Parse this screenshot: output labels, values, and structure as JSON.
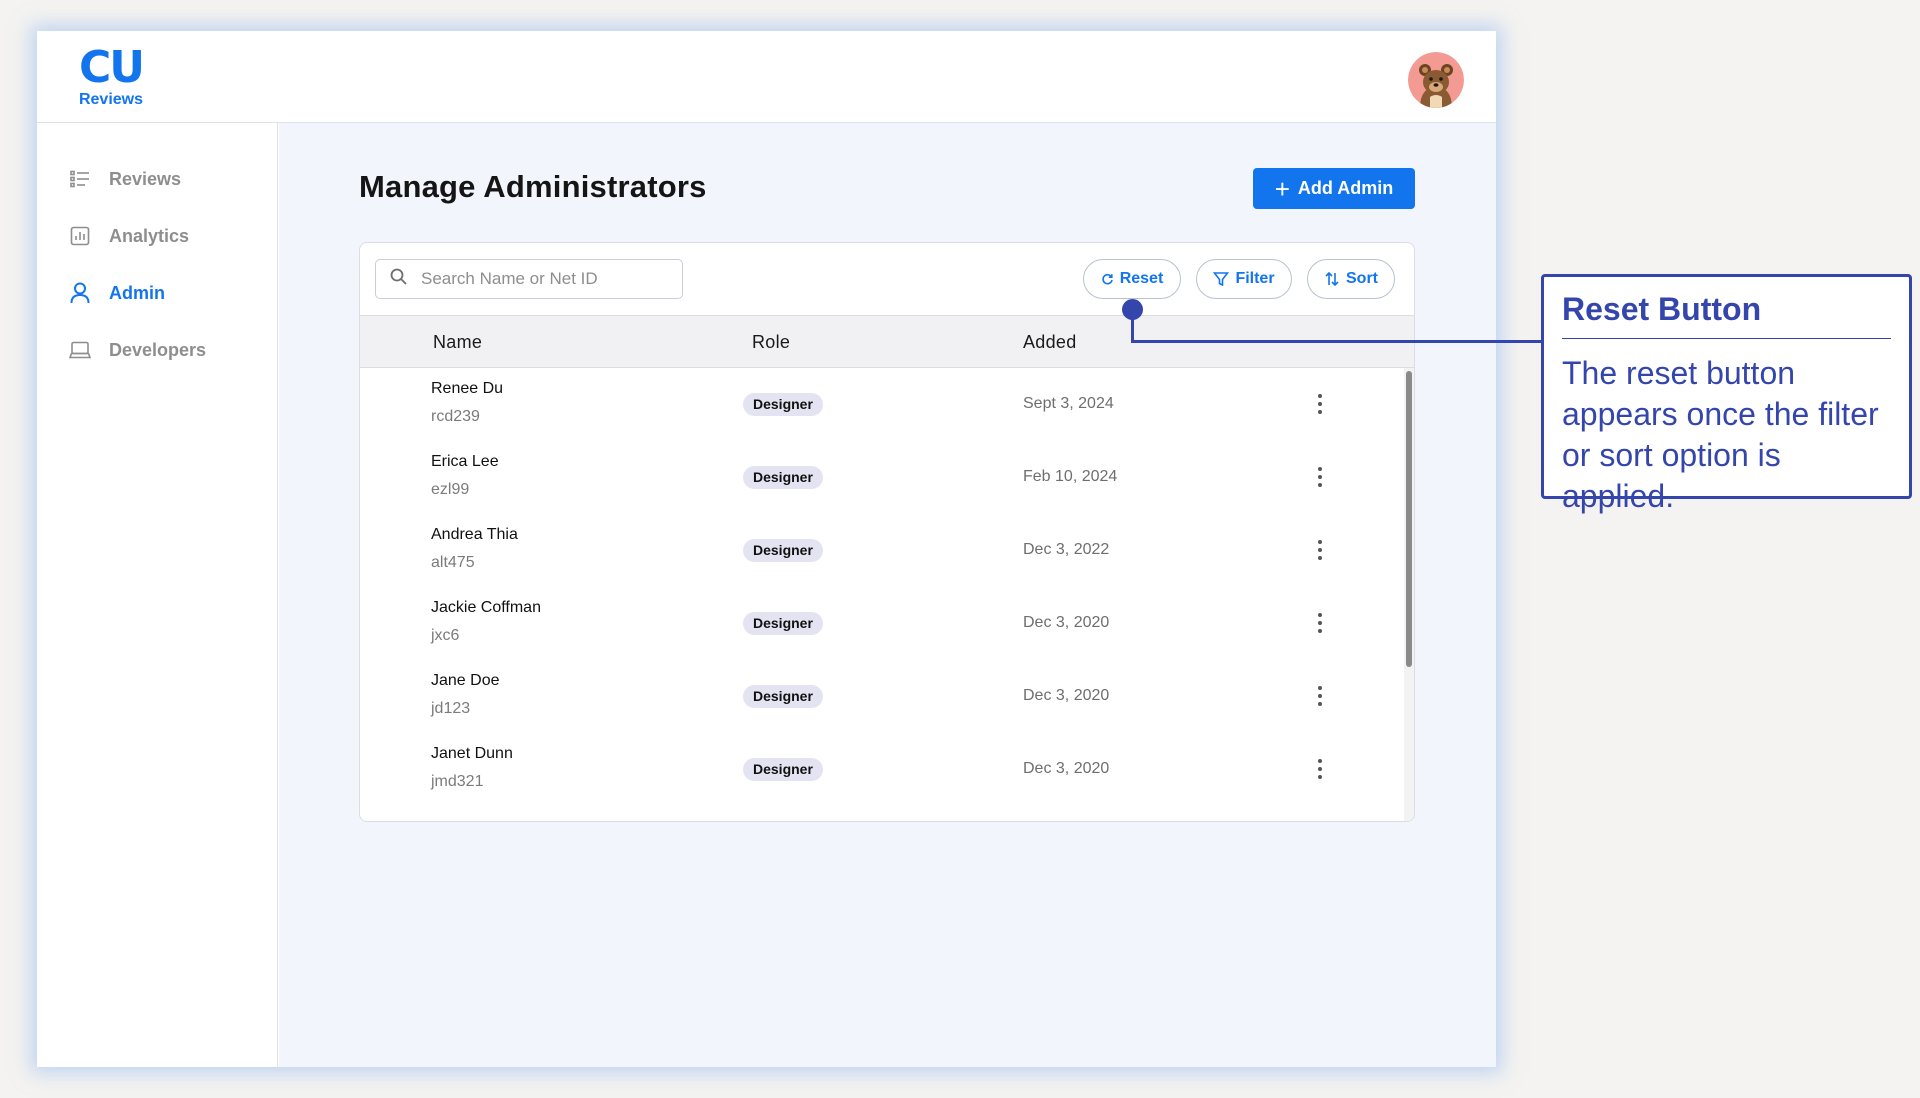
{
  "app": {
    "logo_mark": "CU",
    "logo_text": "Reviews",
    "accent_color": "#1375ee"
  },
  "sidebar": {
    "items": [
      {
        "label": "Reviews",
        "icon": "list-icon",
        "active": false
      },
      {
        "label": "Analytics",
        "icon": "bar-chart-icon",
        "active": false
      },
      {
        "label": "Admin",
        "icon": "user-icon",
        "active": true
      },
      {
        "label": "Developers",
        "icon": "laptop-icon",
        "active": false
      }
    ]
  },
  "header": {
    "avatar": "bear-avatar-icon"
  },
  "main": {
    "title": "Manage Administrators",
    "add_button_label": "Add Admin",
    "search": {
      "placeholder": "Search Name or Net ID",
      "value": ""
    },
    "toolbar": {
      "reset_label": "Reset",
      "filter_label": "Filter",
      "sort_label": "Sort"
    },
    "table": {
      "columns": [
        "Name",
        "Role",
        "Added"
      ],
      "rows": [
        {
          "name": "Renee Du",
          "net_id": "rcd239",
          "role": "Designer",
          "added": "Sept 3, 2024"
        },
        {
          "name": "Erica Lee",
          "net_id": "ezl99",
          "role": "Designer",
          "added": "Feb 10, 2024"
        },
        {
          "name": "Andrea Thia",
          "net_id": "alt475",
          "role": "Designer",
          "added": "Dec 3, 2022"
        },
        {
          "name": "Jackie Coffman",
          "net_id": "jxc6",
          "role": "Designer",
          "added": "Dec 3, 2020"
        },
        {
          "name": "Jane Doe",
          "net_id": "jd123",
          "role": "Designer",
          "added": "Dec 3, 2020"
        },
        {
          "name": "Janet Dunn",
          "net_id": "jmd321",
          "role": "Designer",
          "added": "Dec 3, 2020"
        }
      ]
    }
  },
  "annotation": {
    "title": "Reset Button",
    "body": "The reset button appears once the filter or sort option is applied.",
    "color": "#3446ac"
  }
}
